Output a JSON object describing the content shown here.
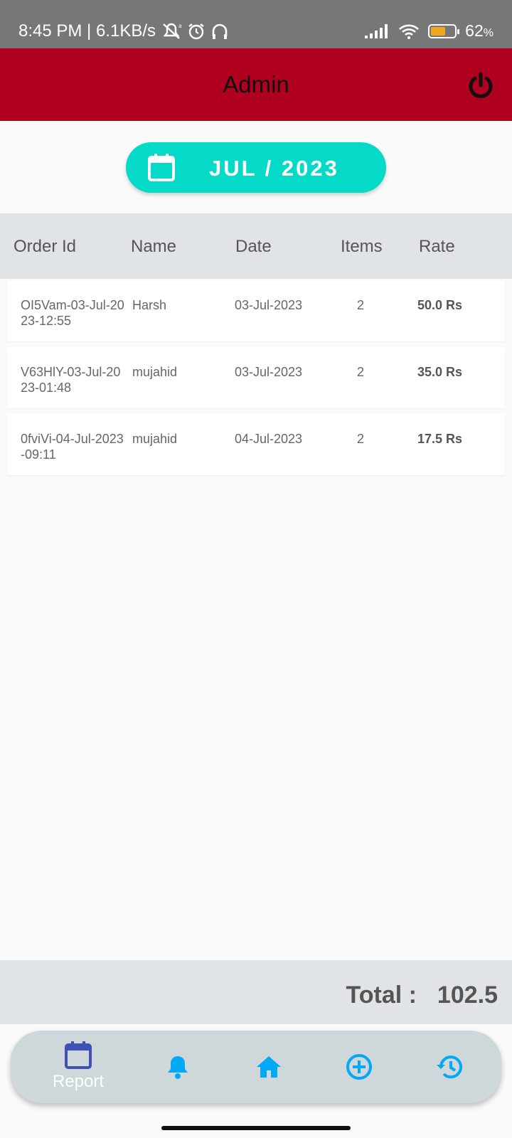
{
  "status_bar": {
    "time_speed": "8:45 PM | 6.1KB/s",
    "battery": "62",
    "battery_unit": "%",
    "battery_level": 0.62,
    "icons": [
      "mute-icon",
      "alarm-icon",
      "headphones-icon",
      "signal-icon",
      "wifi-icon",
      "battery-icon"
    ]
  },
  "app_bar": {
    "title": "Admin",
    "power_icon": "power-icon",
    "color": "#b00020"
  },
  "month_picker": {
    "label": "JUL / 2023",
    "icon": "calendar-icon",
    "color": "#05d9c7"
  },
  "table": {
    "headers": [
      "Order Id",
      "Name",
      "Date",
      "Items",
      "Rate"
    ],
    "rows": [
      {
        "order_id": "OI5Vam-03-Jul-2023-12:55",
        "name": "Harsh",
        "date": "03-Jul-2023",
        "items": "2",
        "rate": "50.0 Rs"
      },
      {
        "order_id": "V63HlY-03-Jul-2023-01:48",
        "name": "mujahid",
        "date": "03-Jul-2023",
        "items": "2",
        "rate": "35.0 Rs"
      },
      {
        "order_id": "0fviVi-04-Jul-2023-09:11",
        "name": "mujahid",
        "date": "04-Jul-2023",
        "items": "2",
        "rate": "17.5 Rs"
      }
    ]
  },
  "total": {
    "label": "Total :",
    "value": "102.5"
  },
  "bottom_nav": {
    "items": [
      {
        "label": "Report",
        "icon": "calendar-icon",
        "active": true
      },
      {
        "label": "",
        "icon": "bell-icon"
      },
      {
        "label": "",
        "icon": "home-icon"
      },
      {
        "label": "",
        "icon": "add-circle-icon"
      },
      {
        "label": "",
        "icon": "history-icon"
      }
    ],
    "active_color": "#3f51b5",
    "icon_color": "#03a9f4"
  }
}
